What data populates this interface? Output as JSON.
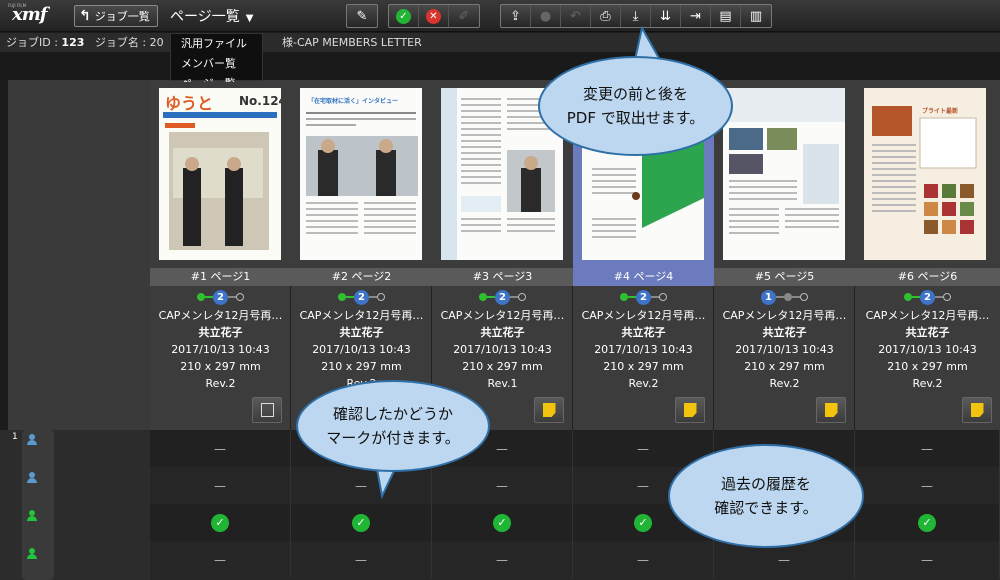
{
  "toolbar": {
    "logo_text": "xmf",
    "logo_small": "FUJI FILM",
    "job_list_label": "ジョブ一覧",
    "page_list_label": "ページ一覧",
    "page_list_caret": "▼"
  },
  "info": {
    "job_id_label": "ジョブID : ",
    "job_id_value": "123",
    "job_name_label": "ジョブ名 : 20",
    "job_name_tail": "様-CAP   MEMBERS   LETTER"
  },
  "dropdown": {
    "items": [
      "汎用ファイル",
      "メンバー覧",
      "ページ一覧"
    ]
  },
  "pages": [
    {
      "label": "#1 ページ1",
      "step": "2",
      "title": "CAPメンレタ12月号再…",
      "author": "共立花子",
      "date": "2017/10/13 10:43",
      "size": "210 x 297 mm",
      "rev": "Rev.2",
      "note": "white"
    },
    {
      "label": "#2 ページ2",
      "step": "2",
      "title": "CAPメンレタ12月号再…",
      "author": "共立花子",
      "date": "2017/10/13 10:43",
      "size": "210 x 297 mm",
      "rev": "Rev.2",
      "note": "yellow"
    },
    {
      "label": "#3 ページ3",
      "step": "2",
      "title": "CAPメンレタ12月号再…",
      "author": "共立花子",
      "date": "2017/10/13 10:43",
      "size": "210 x 297 mm",
      "rev": "Rev.1",
      "note": "yellow"
    },
    {
      "label": "#4 ページ4",
      "step": "2",
      "title": "CAPメンレタ12月号再…",
      "author": "共立花子",
      "date": "2017/10/13 10:43",
      "size": "210 x 297 mm",
      "rev": "Rev.2",
      "note": "yellow"
    },
    {
      "label": "#5 ページ5",
      "step": "1",
      "title": "CAPメンレタ12月号再…",
      "author": "共立花子",
      "date": "2017/10/13 10:43",
      "size": "210 x 297 mm",
      "rev": "Rev.2",
      "note": "yellow"
    },
    {
      "label": "#6 ページ6",
      "step": "2",
      "title": "CAPメンレタ12月号再…",
      "author": "共立花子",
      "date": "2017/10/13 10:43",
      "size": "210 x 297 mm",
      "rev": "Rev.2",
      "note": "yellow"
    }
  ],
  "thumb_text": {
    "p1_masthead": "ゆうと",
    "p1_issue": "No.124",
    "p2_heading": "「在宅取材に活く」インタビュー",
    "p6_heading": "ブライト最新"
  },
  "rows": {
    "row_number": "1",
    "dash": "—",
    "check": "✓",
    "colors": {
      "blue_person": "#5b9bd5",
      "green_person": "#21c43a"
    }
  },
  "callouts": {
    "pdf": [
      "変更の前と後を",
      "PDF で取出せます。"
    ],
    "mark": [
      "確認したかどうか",
      "マークが付きます。"
    ],
    "history": [
      "過去の履歴を",
      "確認できます。"
    ]
  }
}
